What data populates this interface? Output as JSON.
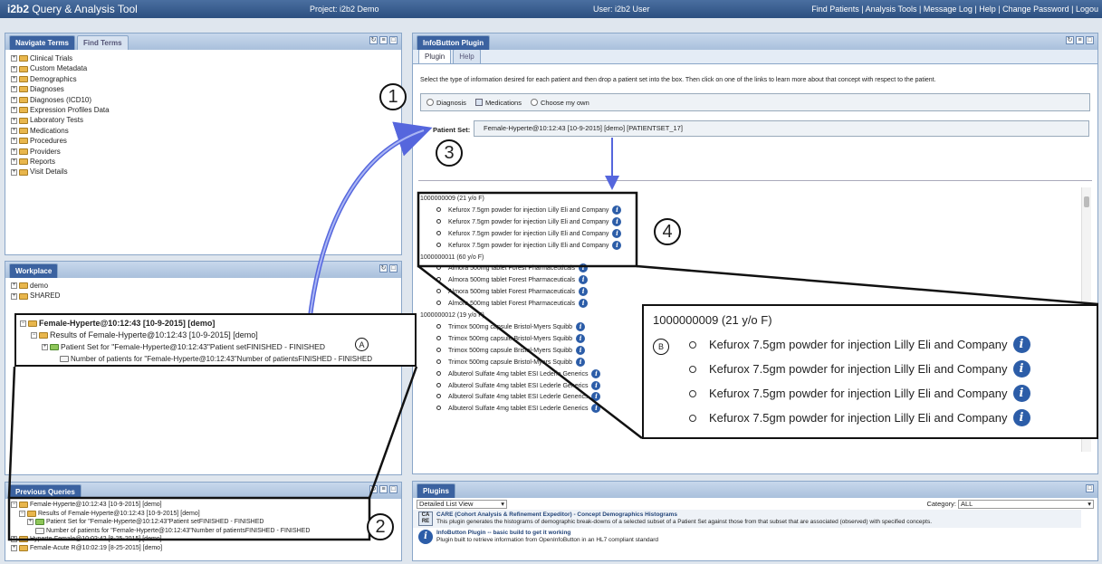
{
  "app": {
    "brand_bold": "i2b2",
    "brand_rest": " Query & Analysis Tool",
    "project": "Project: i2b2 Demo",
    "user": "User: i2b2 User",
    "links": [
      "Find Patients",
      "Analysis Tools",
      "Message Log",
      "Help",
      "Change Password",
      "Logou"
    ]
  },
  "navigate": {
    "tabs": [
      "Navigate Terms",
      "Find Terms"
    ],
    "items": [
      "Clinical Trials",
      "Custom Metadata",
      "Demographics",
      "Diagnoses",
      "Diagnoses (ICD10)",
      "Expression Profiles Data",
      "Laboratory Tests",
      "Medications",
      "Procedures",
      "Providers",
      "Reports",
      "Visit Details"
    ]
  },
  "workplace": {
    "tab": "Workplace",
    "items": [
      "demo",
      "SHARED"
    ]
  },
  "workplace_zoom": {
    "root": "Female-Hyperte@10:12:43 [10-9-2015] [demo]",
    "results": "Results of Female-Hyperte@10:12:43 [10-9-2015] [demo]",
    "patient_set": "Patient Set for \"Female-Hyperte@10:12:43\"Patient setFINISHED - FINISHED",
    "count": "Number of patients for \"Female-Hyperte@10:12:43\"Number of patientsFINISHED - FINISHED",
    "marker": "A"
  },
  "previous": {
    "tab": "Previous Queries",
    "root": "Female-Hyperte@10:12:43 [10-9-2015] [demo]",
    "results": "Results of Female-Hyperte@10:12:43 [10-9-2015] [demo]",
    "patient_set": "Patient Set for \"Female-Hyperte@10:12:43\"Patient setFINISHED - FINISHED",
    "count": "Number of patients for \"Female-Hyperte@10:12:43\"Number of patientsFINISHED - FINISHED",
    "q2": "Hyperte-Female@10:02:42 [8-25-2015] [demo]",
    "q3": "Female-Acute R@10:02:19 [8-25-2015] [demo]"
  },
  "infobutton": {
    "panel_tab": "InfoButton Plugin",
    "subtabs": [
      "Plugin",
      "Help"
    ],
    "instruction": "Select the type of information desired for each patient and then drop a patient set into the box. Then click on one of the links to learn more about that concept with respect to the patient.",
    "options": [
      "Diagnosis",
      "Medications",
      "Choose my own"
    ],
    "patient_set_label": "Patient Set:",
    "patient_set_value": "Female-Hyperte@10:12:43 [10-9-2015] [demo] [PATIENTSET_17]"
  },
  "patients": [
    {
      "header": "1000000009 (21 y/o F)",
      "meds": [
        "Kefurox 7.5gm powder for injection Lilly Eli and Company",
        "Kefurox 7.5gm powder for injection Lilly Eli and Company",
        "Kefurox 7.5gm powder for injection Lilly Eli and Company",
        "Kefurox 7.5gm powder for injection Lilly Eli and Company"
      ]
    },
    {
      "header": "1000000011 (60 y/o F)",
      "meds": [
        "Almora 500mg tablet Forest Pharmaceuticals",
        "Almora 500mg tablet Forest Pharmaceuticals",
        "Almora 500mg tablet Forest Pharmaceuticals",
        "Almora 500mg tablet Forest Pharmaceuticals"
      ]
    },
    {
      "header": "1000000012 (19 y/o F)",
      "meds": [
        "Trimox 500mg capsule Bristol-Myers Squibb",
        "Trimox 500mg capsule Bristol-Myers Squibb",
        "Trimox 500mg capsule Bristol-Myers Squibb",
        "Trimox 500mg capsule Bristol-Myers Squibb",
        "Albuterol Sulfate 4mg tablet ESI Lederle Generics",
        "Albuterol Sulfate 4mg tablet ESI Lederle Generics",
        "Albuterol Sulfate 4mg tablet ESI Lederle Generics",
        "Albuterol Sulfate 4mg tablet ESI Lederle Generics"
      ]
    }
  ],
  "zoom_patient": {
    "header": "1000000009 (21 y/o F)",
    "marker": "B",
    "meds": [
      "Kefurox 7.5gm powder for injection Lilly Eli and Company",
      "Kefurox 7.5gm powder for injection Lilly Eli and Company",
      "Kefurox 7.5gm powder for injection Lilly Eli and Company",
      "Kefurox 7.5gm powder for injection Lilly Eli and Company"
    ]
  },
  "plugins": {
    "tab": "Plugins",
    "view": "Detailed List View",
    "category_label": "Category:",
    "category_value": "ALL",
    "items": [
      {
        "icon": "CA RE",
        "title": "CARE (Cohort Analysis & Refinement Expeditor) - Concept Demographics Histograms",
        "desc": "This plugin generates the histograms of demographic break-downs of a selected subset of a Patient Set against those from that subset that are associated (observed) with specified concepts."
      },
      {
        "icon": "i",
        "title": "InfoButton Plugin -- basic build to get it working",
        "desc": "Plugin built to retrieve information from OpenInfoButton in an HL7 compliant standard"
      }
    ]
  },
  "markers": [
    "1",
    "2",
    "3",
    "4"
  ],
  "icons": {
    "info": "info-icon",
    "folder": "folder-icon",
    "expand": "expand-icon"
  },
  "colors": {
    "header": "#2c4f80",
    "info": "#2c5da8",
    "arrow": "#5566dd"
  }
}
